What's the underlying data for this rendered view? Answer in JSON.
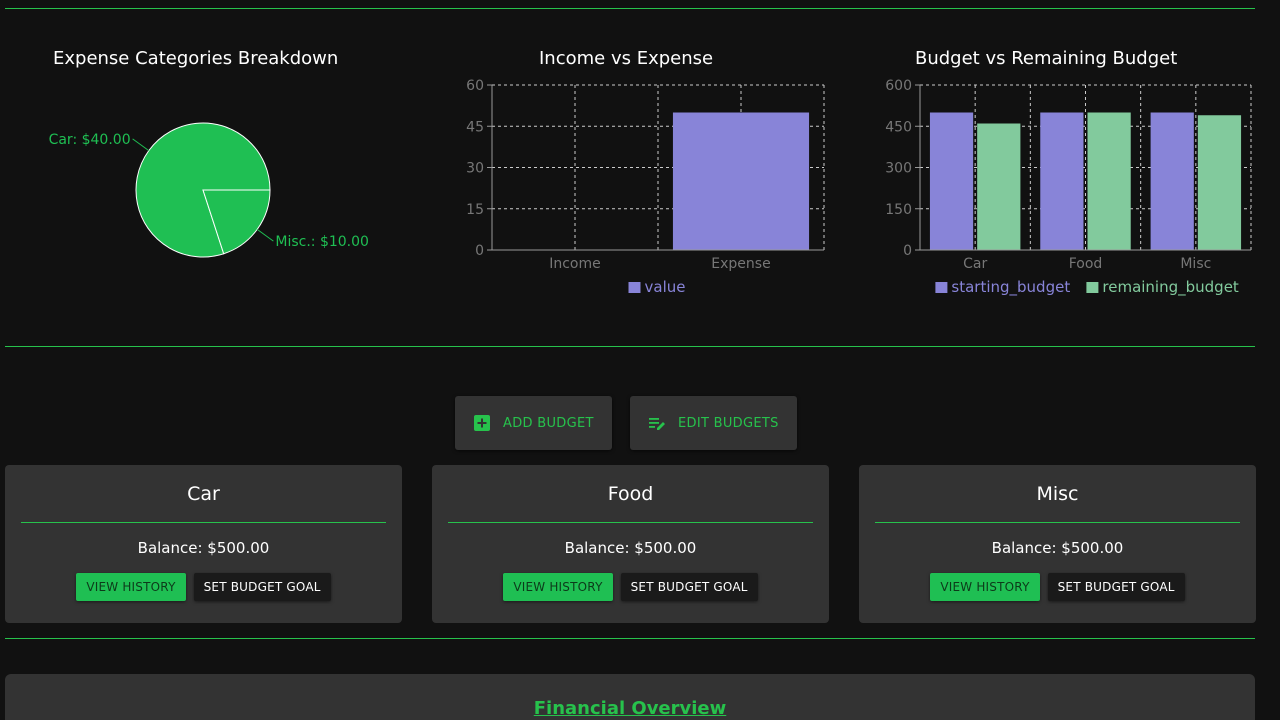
{
  "colors": {
    "accent": "#27c24c",
    "pie_fill": "#1fbf53",
    "bar_purple": "#8884d8",
    "bar_green": "#82ca9d",
    "card_bg": "#333333",
    "page_bg": "#111111"
  },
  "charts": {
    "pie": {
      "title": "Expense Categories Breakdown"
    },
    "income_expense": {
      "title": "Income vs Expense"
    },
    "budget_remaining": {
      "title": "Budget vs Remaining Budget"
    }
  },
  "chart_data": [
    {
      "type": "pie",
      "title": "Expense Categories Breakdown",
      "slices": [
        {
          "label": "Car: $40.00",
          "name": "Car",
          "value": 40
        },
        {
          "label": "Misc.: $10.00",
          "name": "Misc.",
          "value": 10
        }
      ]
    },
    {
      "type": "bar",
      "title": "Income vs Expense",
      "categories": [
        "Income",
        "Expense"
      ],
      "series": [
        {
          "name": "value",
          "values": [
            0,
            50
          ]
        }
      ],
      "yticks": [
        0,
        15,
        30,
        45,
        60
      ],
      "ylim": [
        0,
        60
      ],
      "grid": true,
      "legend": "bottom"
    },
    {
      "type": "bar",
      "title": "Budget vs Remaining Budget",
      "categories": [
        "Car",
        "Food",
        "Misc"
      ],
      "series": [
        {
          "name": "starting_budget",
          "values": [
            500,
            500,
            500
          ]
        },
        {
          "name": "remaining_budget",
          "values": [
            460,
            500,
            490
          ]
        }
      ],
      "yticks": [
        0,
        150,
        300,
        450,
        600
      ],
      "ylim": [
        0,
        600
      ],
      "grid": true,
      "legend": "bottom"
    }
  ],
  "toolbar": {
    "add_label": "ADD BUDGET",
    "edit_label": "EDIT BUDGETS"
  },
  "budgets": [
    {
      "name": "Car",
      "balance": "Balance: $500.00",
      "history_label": "VIEW HISTORY",
      "goal_label": "SET BUDGET GOAL"
    },
    {
      "name": "Food",
      "balance": "Balance: $500.00",
      "history_label": "VIEW HISTORY",
      "goal_label": "SET BUDGET GOAL"
    },
    {
      "name": "Misc",
      "balance": "Balance: $500.00",
      "history_label": "VIEW HISTORY",
      "goal_label": "SET BUDGET GOAL"
    }
  ],
  "overview": {
    "title": "Financial Overview"
  }
}
